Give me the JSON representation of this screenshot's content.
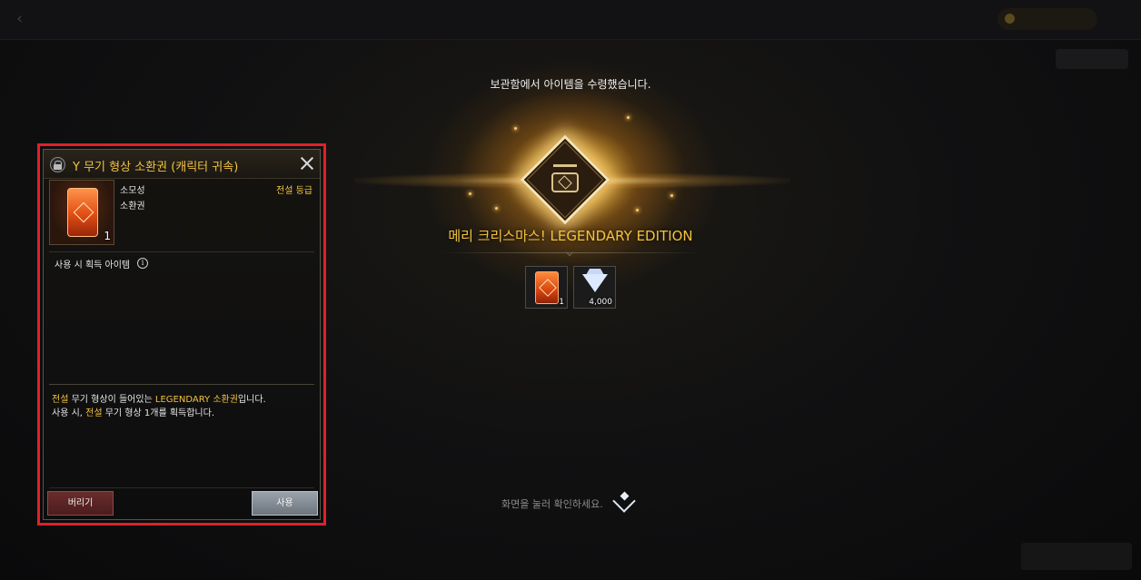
{
  "reward": {
    "header": "보관함에서 아이템을 수령했습니다.",
    "event_title": "메리 크리스마스! LEGENDARY EDITION",
    "items": [
      {
        "icon": "summon-ticket-icon",
        "qty": "1"
      },
      {
        "icon": "diamond-icon",
        "qty": "4,000"
      }
    ],
    "tap_hint": "화면을 눌러 확인하세요."
  },
  "panel": {
    "title": "Y 무기 형상 소환권 (캐릭터 귀속)",
    "item_qty": "1",
    "type_line1": "소모성",
    "type_line2": "소환권",
    "grade": "전설 등급",
    "section_label": "사용 시 획득 아이템",
    "info_glyph": "i",
    "desc": {
      "l1_a": "전설",
      "l1_b": " 무기 형상이 들어있는 ",
      "l1_c": "LEGENDARY 소환권",
      "l1_d": "입니다.",
      "l2_a": "사용 시, ",
      "l2_b": "전설",
      "l2_c": " 무기 형상 1개를 획득합니다."
    },
    "discard_label": "버리기",
    "use_label": "사용"
  },
  "colors": {
    "highlight": "#e0202a",
    "legendary": "#f2c241"
  }
}
